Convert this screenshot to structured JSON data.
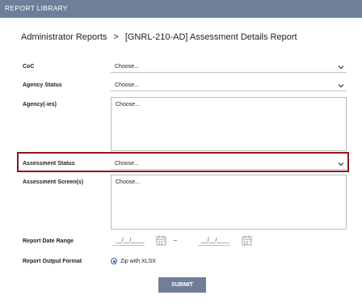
{
  "header": {
    "title": "REPORT LIBRARY"
  },
  "breadcrumb": {
    "parent": "Administrator Reports",
    "separator": ">",
    "current": "[GNRL-210-AD] Assessment Details Report"
  },
  "form": {
    "coc": {
      "label": "CoC",
      "value": "Choose..."
    },
    "agency_status": {
      "label": "Agency Status",
      "value": "Choose..."
    },
    "agencies": {
      "label": "Agency(-ies)",
      "value": "Choose..."
    },
    "assessment_status": {
      "label": "Assessment Status",
      "value": "Choose..."
    },
    "assessment_screens": {
      "label": "Assessment Screen(s)",
      "value": "Choose..."
    },
    "report_date_range": {
      "label": "Report Date Range",
      "start_placeholder": "__/__/____",
      "separator": "–",
      "end_placeholder": "__/__/____"
    },
    "report_output_format": {
      "label": "Report Output Format",
      "selected_option": "Zip with XLSX"
    },
    "submit_label": "SUBMIT"
  },
  "colors": {
    "header_bg": "#6f7f99",
    "highlight_border": "#8b1a1a",
    "radio_accent": "#3b5aa8"
  }
}
